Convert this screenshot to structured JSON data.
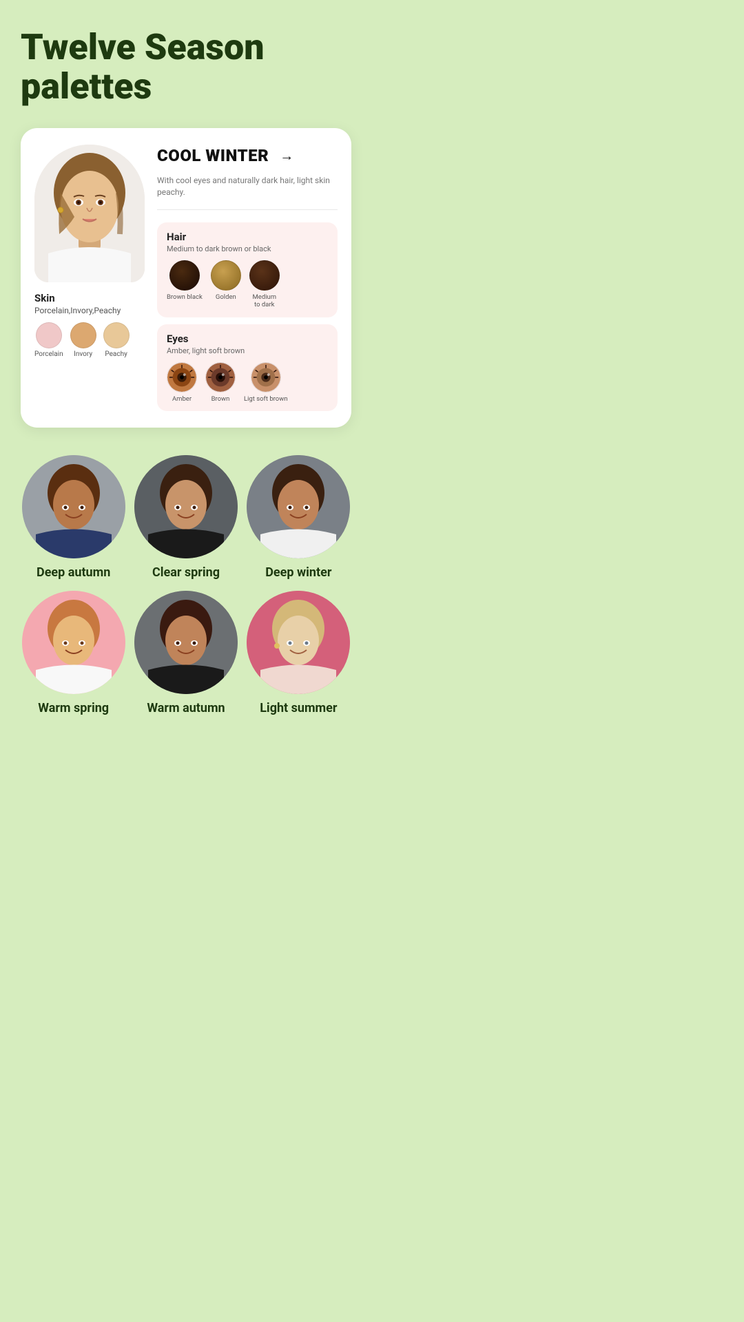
{
  "title": "Twelve Season\npalettes",
  "card": {
    "season_name": "COOL WINTER",
    "season_desc": "With cool eyes and naturally dark hair, light skin peachy.",
    "arrow": "→",
    "skin": {
      "label": "Skin",
      "sublabel": "Porcelain,Invory,Peachy",
      "swatches": [
        {
          "color": "#f0c8c8",
          "label": "Porcelain"
        },
        {
          "color": "#dca870",
          "label": "Invory"
        },
        {
          "color": "#e8c898",
          "label": "Peachy"
        }
      ]
    },
    "hair": {
      "label": "Hair",
      "sublabel": "Medium to dark brown or black",
      "swatches": [
        {
          "color": "#2e1a0e",
          "label": "Brown black"
        },
        {
          "color": "#9e7a3a",
          "label": "Golden"
        },
        {
          "color": "#3e2010",
          "label": "Medium\nto dark"
        }
      ]
    },
    "eyes": {
      "label": "Eyes",
      "sublabel": "Amber, light soft brown",
      "swatches": [
        {
          "color": "#8b4513",
          "pupil": "#3a1a06",
          "label": "Amber"
        },
        {
          "color": "#6b3a2a",
          "pupil": "#2a1008",
          "label": "Brown"
        },
        {
          "color": "#a0704a",
          "pupil": "#4a2a18",
          "label": "Ligt soft\nbrown"
        }
      ]
    }
  },
  "seasons": [
    {
      "name": "Deep autumn",
      "bg": "#9aa0a6"
    },
    {
      "name": "Clear spring",
      "bg": "#5a5f63"
    },
    {
      "name": "Deep winter",
      "bg": "#7a8087"
    },
    {
      "name": "Warm spring",
      "bg": "#f4a8b0"
    },
    {
      "name": "Warm autumn",
      "bg": "#6b6f72"
    },
    {
      "name": "Light summer",
      "bg": "#d4607a"
    }
  ],
  "season_avatar_colors": {
    "deep_autumn": {
      "skin": "#b8794a",
      "hair": "#5a2e10",
      "bg": "#9aa0a6"
    },
    "clear_spring": {
      "skin": "#c8946a",
      "hair": "#3a2010",
      "bg": "#5a5f63"
    },
    "deep_winter": {
      "skin": "#c0845a",
      "hair": "#3a2010",
      "bg": "#7a8087"
    },
    "warm_spring": {
      "skin": "#e8b87a",
      "hair": "#c87840",
      "bg": "#f4a8b0"
    },
    "warm_autumn": {
      "skin": "#c0845a",
      "hair": "#3a1a10",
      "bg": "#6b6f72"
    },
    "light_summer": {
      "skin": "#e8d0a8",
      "hair": "#d4b878",
      "bg": "#d4607a"
    }
  }
}
